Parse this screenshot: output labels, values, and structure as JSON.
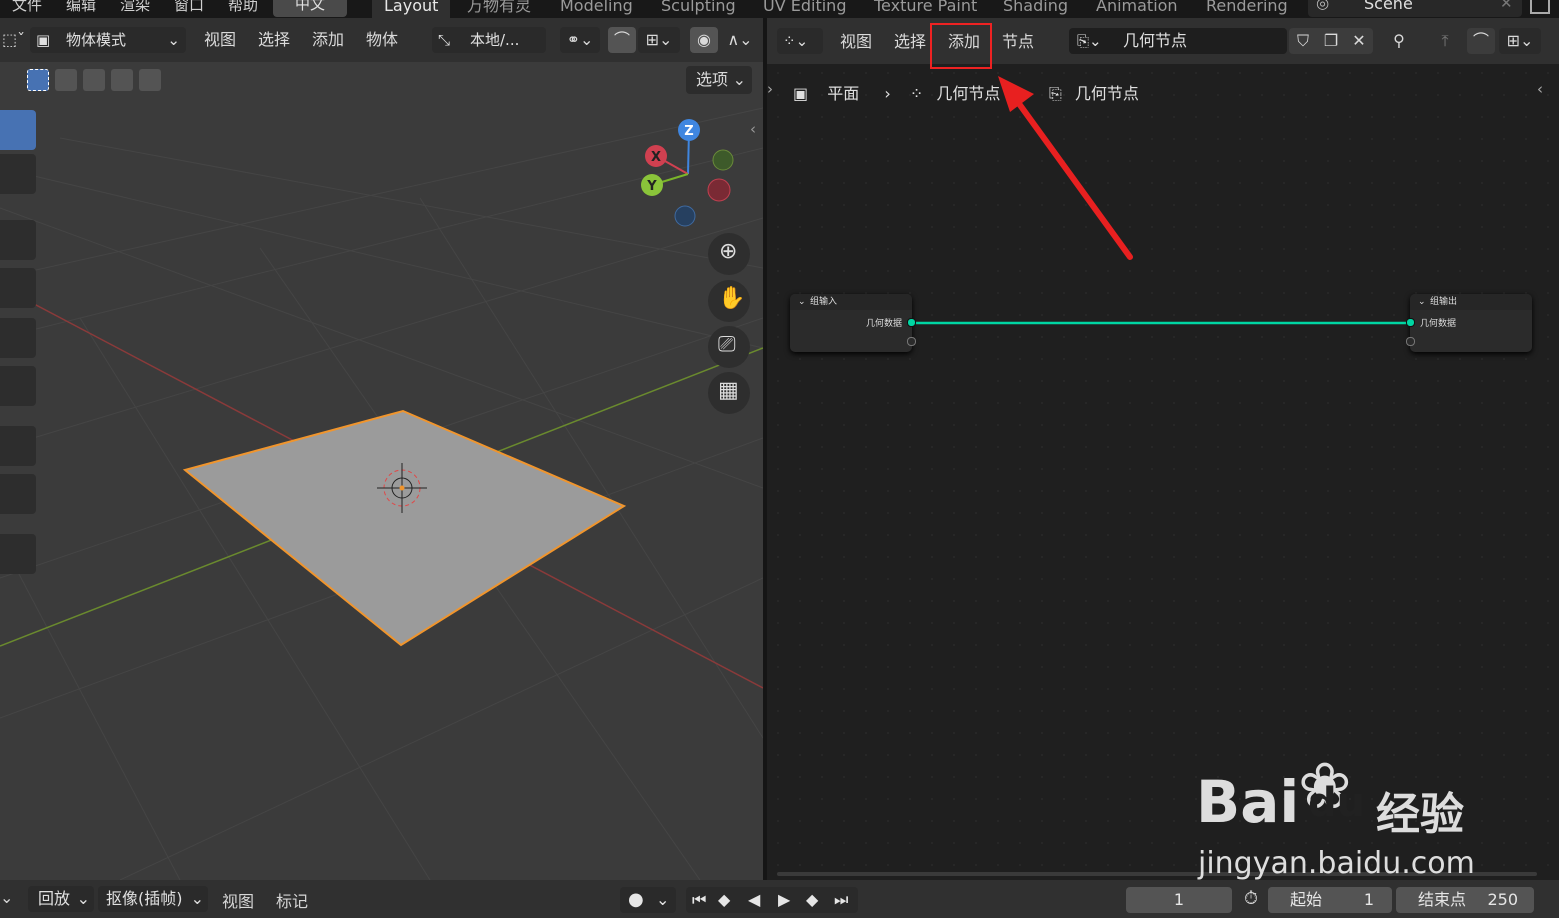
{
  "top_menu": [
    "文件",
    "编辑",
    "渲染",
    "窗口",
    "帮助"
  ],
  "language_button": "中文",
  "workspaces": {
    "tabs": [
      "Layout",
      "万物有灵",
      "Modeling",
      "Sculpting",
      "UV Editing",
      "Texture Paint",
      "Shading",
      "Animation",
      "Rendering"
    ],
    "active": "Layout"
  },
  "scene_name": "Scene",
  "viewport": {
    "mode": "物体模式",
    "menus": [
      "视图",
      "选择",
      "添加",
      "物体"
    ],
    "transform_orientation": "本地/...",
    "options_label": "选项",
    "gizmo_axes": {
      "x": "X",
      "y": "Y",
      "z": "Z"
    }
  },
  "node_editor": {
    "menus": [
      "视图",
      "选择",
      "添加",
      "节点"
    ],
    "highlighted_menu": "添加",
    "tree_name": "几何节点",
    "breadcrumb": [
      "平面",
      "几何节点",
      "几何节点"
    ],
    "nodes": {
      "group_input": {
        "title": "组输入",
        "socket": "几何数据"
      },
      "group_output": {
        "title": "组输出",
        "socket": "几何数据"
      }
    }
  },
  "timeline": {
    "menus": [
      "回放",
      "抠像(插帧)",
      "视图",
      "标记"
    ],
    "current_frame": "1",
    "start_label": "起始",
    "start_value": "1",
    "end_label": "结束点",
    "end_value": "250"
  },
  "watermark": {
    "brand": "Bai",
    "brand2": "du",
    "cn": "经验",
    "url": "jingyan.baidu.com"
  },
  "colors": {
    "accent_blue": "#4772b3",
    "highlight_red": "#e22222",
    "geometry_link": "#00d6a3",
    "selection_orange": "#f0952d"
  }
}
